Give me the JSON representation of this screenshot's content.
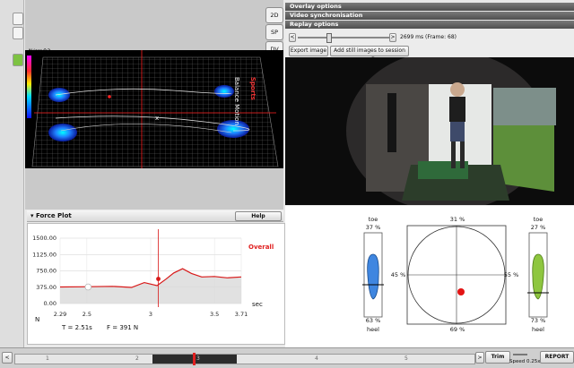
{
  "view_buttons": [
    "2D",
    "SP",
    "DV"
  ],
  "pressure_view": {
    "unit_label": "N/cm^2",
    "side_text_1": "Balance Motion",
    "side_text_2": "Sports"
  },
  "right_panel": {
    "overlay_options": "Overlay options",
    "video_sync": "Video synchronisation",
    "replay_options": "Replay options",
    "slider_value": "2699 ms  (Frame: 68)",
    "export_image": "Export image",
    "add_still_images": "Add still images to session media"
  },
  "force_plot": {
    "title": "Force Plot",
    "help": "Help",
    "series_label": "Overall",
    "y_ticks": [
      "1500.00",
      "1125.00",
      "750.00",
      "375.00",
      "0.00"
    ],
    "y_unit": "N",
    "x_ticks": [
      "2.29",
      "2.5",
      "3",
      "3.5",
      "3.71"
    ],
    "x_unit": "sec",
    "t_readout": "T = 2.51s",
    "f_readout": "F = 391 N"
  },
  "chart_data": {
    "type": "line",
    "series": [
      {
        "name": "Overall",
        "x": [
          2.29,
          2.45,
          2.7,
          2.85,
          2.95,
          3.05,
          3.12,
          3.18,
          3.25,
          3.32,
          3.4,
          3.5,
          3.6,
          3.71
        ],
        "y": [
          380,
          385,
          395,
          370,
          480,
          410,
          560,
          700,
          800,
          690,
          610,
          620,
          590,
          610
        ]
      }
    ],
    "xlim": [
      2.29,
      3.71
    ],
    "ylim": [
      0,
      1500
    ],
    "markers": {
      "current_x": 3.06,
      "current_y": 565,
      "cursor_x": 2.51
    }
  },
  "balance": {
    "left": {
      "toe_label": "toe",
      "toe_pct": "37 %",
      "heel_pct": "63 %",
      "heel_label": "heel",
      "color": "#3f86e0"
    },
    "right": {
      "toe_label": "toe",
      "toe_pct": "27 %",
      "heel_pct": "73 %",
      "heel_label": "heel",
      "color": "#8ec63f"
    },
    "front_pct": "31 %",
    "back_pct": "69 %",
    "left_pct": "45 %",
    "right_pct": "55 %",
    "cop_color": "#e31414"
  },
  "timeline": {
    "ticks": [
      "1",
      "2",
      "3",
      "4",
      "5"
    ],
    "trim": "Trim",
    "speed": "Speed 0.25x",
    "report": "REPORT"
  }
}
